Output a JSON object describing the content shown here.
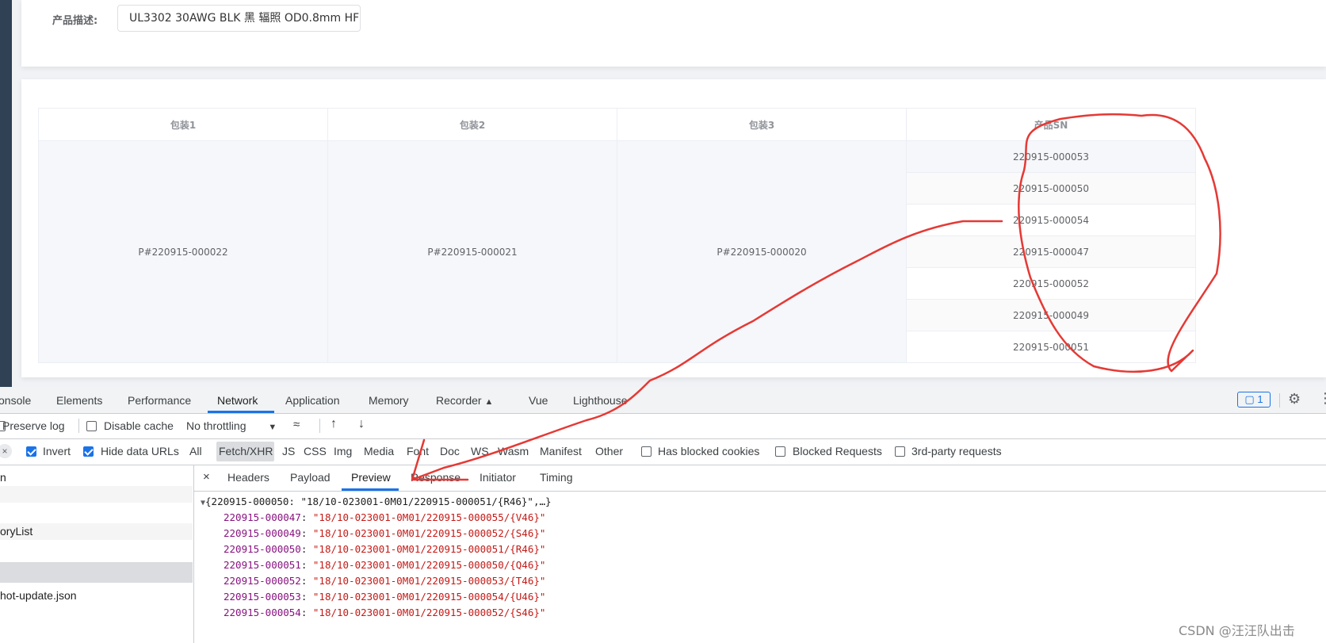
{
  "header": {
    "desc_label": "产品描述:",
    "desc_value": "UL3302 30AWG BLK 黑 辐照 OD0.8mm HF"
  },
  "table": {
    "headers": [
      "包装1",
      "包装2",
      "包装3",
      "产品SN"
    ],
    "pack1": "P#220915-000022",
    "pack2": "P#220915-000021",
    "pack3": "P#220915-000020",
    "sns": [
      "220915-000053",
      "220915-000050",
      "220915-000054",
      "220915-000047",
      "220915-000052",
      "220915-000049",
      "220915-000051"
    ]
  },
  "devtools": {
    "tabs": [
      "onsole",
      "Elements",
      "Performance",
      "Network",
      "Application",
      "Memory",
      "Recorder",
      "Vue",
      "Lighthouse"
    ],
    "active_tab": "Network",
    "issues_count": "1",
    "toolbar": {
      "preserve_log": "Preserve log",
      "disable_cache": "Disable cache",
      "throttling": "No throttling"
    },
    "filters": {
      "invert": "Invert",
      "hide_data_urls": "Hide data URLs",
      "types": [
        "All",
        "Fetch/XHR",
        "JS",
        "CSS",
        "Img",
        "Media",
        "Font",
        "Doc",
        "WS",
        "Wasm",
        "Manifest",
        "Other"
      ],
      "active_type": "Fetch/XHR",
      "has_blocked_cookies": "Has blocked cookies",
      "blocked_requests": "Blocked Requests",
      "third_party": "3rd-party requests"
    },
    "requests": [
      "n",
      "",
      "",
      "oryList",
      "",
      "",
      "hot-update.json"
    ],
    "detail_tabs": [
      "Headers",
      "Payload",
      "Preview",
      "Response",
      "Initiator",
      "Timing"
    ],
    "active_detail_tab": "Preview",
    "preview": {
      "summary": "{220915-000050: \"18/10-023001-0M01/220915-000051/{R46}\",…}",
      "entries": [
        {
          "key": "220915-000047",
          "value": "\"18/10-023001-0M01/220915-000055/{V46}\""
        },
        {
          "key": "220915-000049",
          "value": "\"18/10-023001-0M01/220915-000052/{S46}\""
        },
        {
          "key": "220915-000050",
          "value": "\"18/10-023001-0M01/220915-000051/{R46}\""
        },
        {
          "key": "220915-000051",
          "value": "\"18/10-023001-0M01/220915-000050/{Q46}\""
        },
        {
          "key": "220915-000052",
          "value": "\"18/10-023001-0M01/220915-000053/{T46}\""
        },
        {
          "key": "220915-000053",
          "value": "\"18/10-023001-0M01/220915-000054/{U46}\""
        },
        {
          "key": "220915-000054",
          "value": "\"18/10-023001-0M01/220915-000052/{S46}\""
        }
      ]
    }
  },
  "watermark": "CSDN @汪汪队出击",
  "colors": {
    "sidebar": "#304156",
    "devtools_accent": "#1a73e8",
    "annotation": "#e53935",
    "json_key": "#881280",
    "json_string": "#c41a16"
  }
}
